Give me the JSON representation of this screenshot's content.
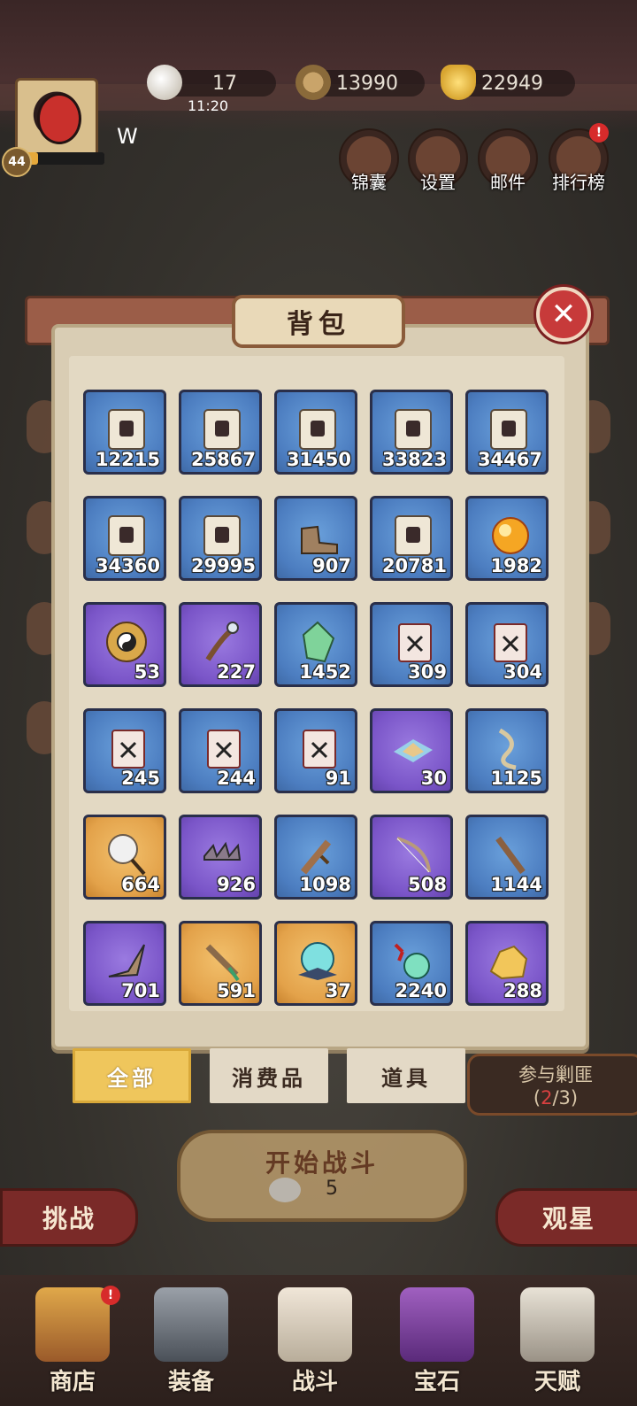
{
  "player": {
    "name": "W",
    "level": "44",
    "xp_fraction": 0.22
  },
  "resources": {
    "stamina": {
      "value": "17",
      "timer": "11:20",
      "icon": "egg-icon"
    },
    "coins": {
      "value": "13990",
      "icon": "coin-icon"
    },
    "gold": {
      "value": "22949",
      "icon": "gold-ingot-icon"
    }
  },
  "top_buttons": [
    {
      "label": "锦囊",
      "icon": "pouch-icon",
      "badge": ""
    },
    {
      "label": "设置",
      "icon": "gear-icon",
      "badge": ""
    },
    {
      "label": "邮件",
      "icon": "mail-icon",
      "badge": ""
    },
    {
      "label": "排行榜",
      "icon": "ranking-icon",
      "badge": "!"
    }
  ],
  "bag": {
    "title": "背包",
    "items": [
      {
        "count": "12215",
        "rarity": "blue",
        "icon": "scroll-icon"
      },
      {
        "count": "25867",
        "rarity": "blue",
        "icon": "scroll-icon"
      },
      {
        "count": "31450",
        "rarity": "blue",
        "icon": "scroll-icon"
      },
      {
        "count": "33823",
        "rarity": "blue",
        "icon": "scroll-icon"
      },
      {
        "count": "34467",
        "rarity": "blue",
        "icon": "scroll-icon"
      },
      {
        "count": "34360",
        "rarity": "blue",
        "icon": "scroll-icon"
      },
      {
        "count": "29995",
        "rarity": "blue",
        "icon": "scroll-icon"
      },
      {
        "count": "907",
        "rarity": "blue",
        "icon": "boot-icon"
      },
      {
        "count": "20781",
        "rarity": "blue",
        "icon": "scroll-icon"
      },
      {
        "count": "1982",
        "rarity": "blue",
        "icon": "fire-orb-icon"
      },
      {
        "count": "53",
        "rarity": "purple",
        "icon": "taiji-disc-icon"
      },
      {
        "count": "227",
        "rarity": "purple",
        "icon": "staff-icon"
      },
      {
        "count": "1452",
        "rarity": "blue",
        "icon": "jade-crystal-icon"
      },
      {
        "count": "309",
        "rarity": "blue",
        "icon": "manual-icon"
      },
      {
        "count": "304",
        "rarity": "blue",
        "icon": "manual-icon"
      },
      {
        "count": "245",
        "rarity": "blue",
        "icon": "manual-icon"
      },
      {
        "count": "244",
        "rarity": "blue",
        "icon": "manual-icon"
      },
      {
        "count": "91",
        "rarity": "blue",
        "icon": "manual-icon"
      },
      {
        "count": "30",
        "rarity": "purple",
        "icon": "powder-icon"
      },
      {
        "count": "1125",
        "rarity": "blue",
        "icon": "rope-icon"
      },
      {
        "count": "664",
        "rarity": "orange",
        "icon": "mirror-icon"
      },
      {
        "count": "926",
        "rarity": "purple",
        "icon": "caltrops-icon"
      },
      {
        "count": "1098",
        "rarity": "blue",
        "icon": "wooden-sword-icon"
      },
      {
        "count": "508",
        "rarity": "purple",
        "icon": "bow-icon"
      },
      {
        "count": "1144",
        "rarity": "blue",
        "icon": "club-icon"
      },
      {
        "count": "701",
        "rarity": "purple",
        "icon": "boomerang-icon"
      },
      {
        "count": "591",
        "rarity": "orange",
        "icon": "dagger-icon"
      },
      {
        "count": "37",
        "rarity": "orange",
        "icon": "spirit-orb-icon"
      },
      {
        "count": "2240",
        "rarity": "blue",
        "icon": "jade-pendant-icon"
      },
      {
        "count": "288",
        "rarity": "purple",
        "icon": "gold-ore-icon"
      }
    ]
  },
  "tabs": [
    {
      "label": "全部",
      "active": true
    },
    {
      "label": "消费品",
      "active": false
    },
    {
      "label": "道具",
      "active": false
    }
  ],
  "join_bandits": {
    "label": "参与剿匪",
    "progress_current": "2",
    "progress_total": "3"
  },
  "start_battle": {
    "label": "开始战斗",
    "cost": "5"
  },
  "side_buttons": {
    "left": "挑战",
    "right": "观星"
  },
  "bottom_nav": [
    {
      "label": "商店",
      "icon": "shop-icon",
      "badge": "!"
    },
    {
      "label": "装备",
      "icon": "equipment-icon",
      "badge": ""
    },
    {
      "label": "战斗",
      "icon": "battle-icon",
      "badge": ""
    },
    {
      "label": "宝石",
      "icon": "gem-chest-icon",
      "badge": ""
    },
    {
      "label": "天赋",
      "icon": "talent-book-icon",
      "badge": ""
    }
  ]
}
